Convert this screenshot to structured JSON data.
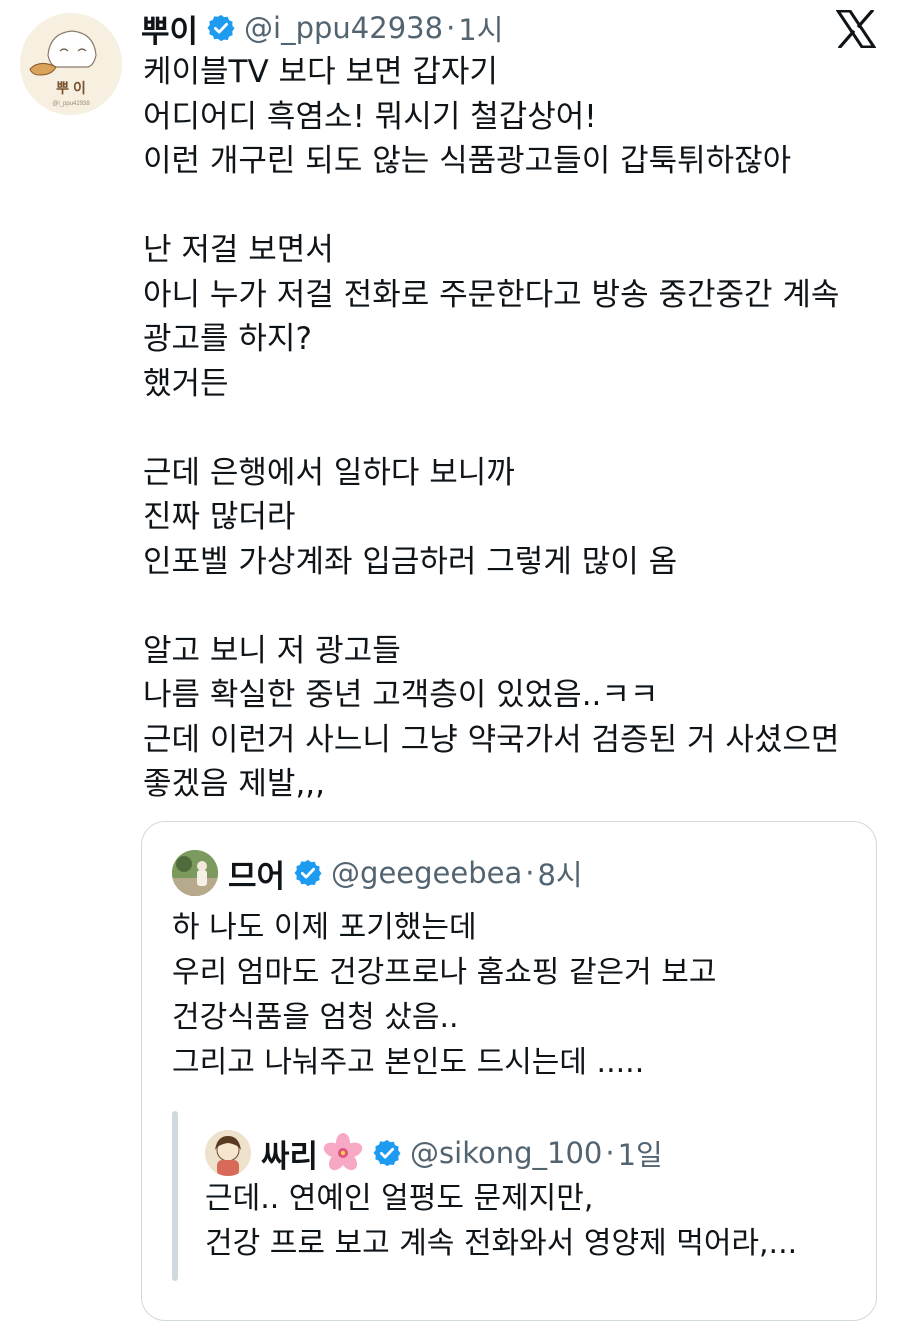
{
  "tweet": {
    "author_name": "뿌이",
    "handle": "@i_ppu42938",
    "separator": "·",
    "time": "1시",
    "avatar_label": "뿌 이",
    "avatar_sub": "@i_ppu42938",
    "lines": [
      "케이블TV 보다 보면 갑자기",
      "어디어디 흑염소! 뭐시기 철갑상어!",
      "이런 개구린 되도 않는 식품광고들이 갑툭튀하잖아",
      "난 저걸 보면서",
      "아니 누가 저걸 전화로 주문한다고 방송 중간중간 계속",
      "광고를 하지?",
      "했거든",
      "근데 은행에서 일하다 보니까",
      "진짜 많더라",
      "인포벨 가상계좌 입금하러 그렇게 많이 옴",
      "알고 보니 저 광고들",
      "나름 확실한 중년 고객층이 있었음..ㅋㅋ",
      "근데 이런거 사느니 그냥 약국가서 검증된 거 사셨으면",
      "좋겠음 제발,,,"
    ]
  },
  "quote": {
    "author_name": "므어",
    "handle": "@geegeebea",
    "separator": "·",
    "time": "8시",
    "lines": [
      "하 나도 이제 포기했는데",
      "우리 엄마도 건강프로나 홈쇼핑 같은거 보고",
      "건강식품을 엄청 샀음..",
      "그리고 나눠주고 본인도 드시는데 ....."
    ]
  },
  "nested_quote": {
    "author_name": "싸리",
    "handle": "@sikong_100",
    "separator": "·",
    "time": "1일",
    "lines": [
      "근데.. 연예인 얼평도 문제지만,",
      "건강 프로 보고 계속 전화와서 영양제 먹어라,..."
    ]
  },
  "colors": {
    "verified": "#1d9bf0",
    "secondary_text": "#536471",
    "border": "#cfd9de"
  }
}
